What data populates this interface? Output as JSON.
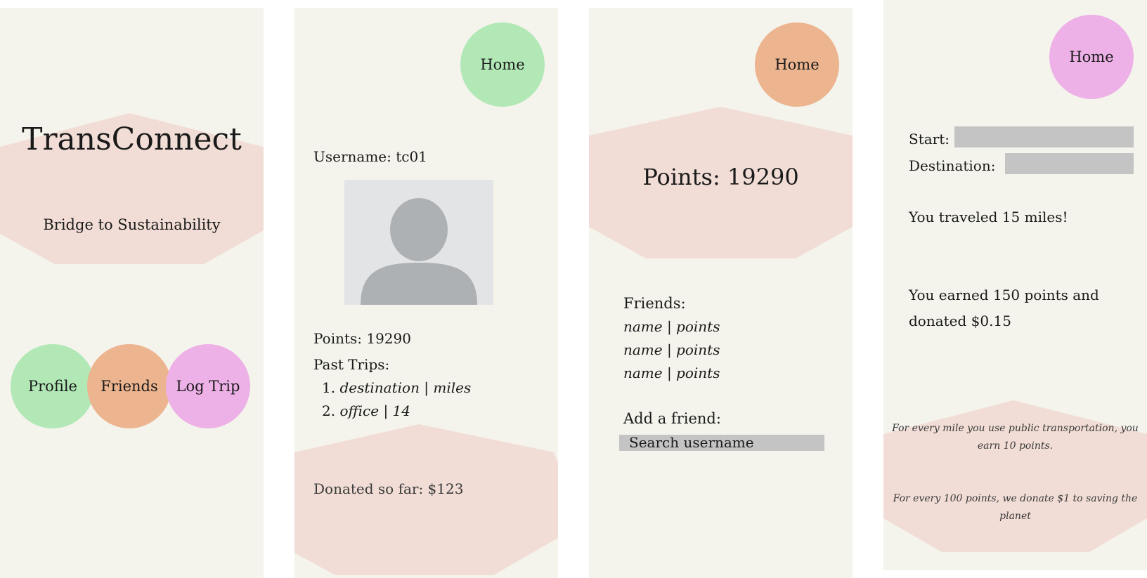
{
  "colors": {
    "panel_bg": "#f4f4ec",
    "hexagon": "#f1ddd6",
    "green": "#b2e8b6",
    "orange": "#ecb48f",
    "pink": "#edb1e7",
    "input": "#c4c4c4"
  },
  "landing": {
    "app_title": "TransConnect",
    "tagline": "Bridge to Sustainability",
    "nav": {
      "profile_label": "Profile",
      "friends_label": "Friends",
      "logtrip_label": "Log Trip"
    }
  },
  "profile": {
    "home_label": "Home",
    "username_line": "Username: tc01",
    "avatar_icon": "user-silhouette-icon",
    "points_line": "Points: 19290",
    "past_trips_heading": "Past Trips:",
    "trips": [
      {
        "number": "1.",
        "text": "destination | miles"
      },
      {
        "number": "2.",
        "text": "office | 14"
      }
    ],
    "donated_line": "Donated so far:  $123"
  },
  "friends": {
    "home_label": "Home",
    "points_line": "Points: 19290",
    "friends_heading": "Friends:",
    "friend_rows": [
      "name | points",
      "name | points",
      "name | points"
    ],
    "add_friend_heading": "Add a friend:",
    "search_placeholder": "Search username"
  },
  "log_trip": {
    "home_label": "Home",
    "start_label": "Start:",
    "start_value": "",
    "destination_label": "Destination:",
    "destination_value": "",
    "traveled_line": "You traveled 15 miles!",
    "earned_line_1": "You earned 150 points and",
    "earned_line_2": "donated $0.15",
    "info_1_line_1": "For every mile you use public transportation, you",
    "info_1_line_2": "earn 10 points.",
    "info_2_line_1": "For every 100 points, we donate $1 to saving the",
    "info_2_line_2": "planet"
  }
}
